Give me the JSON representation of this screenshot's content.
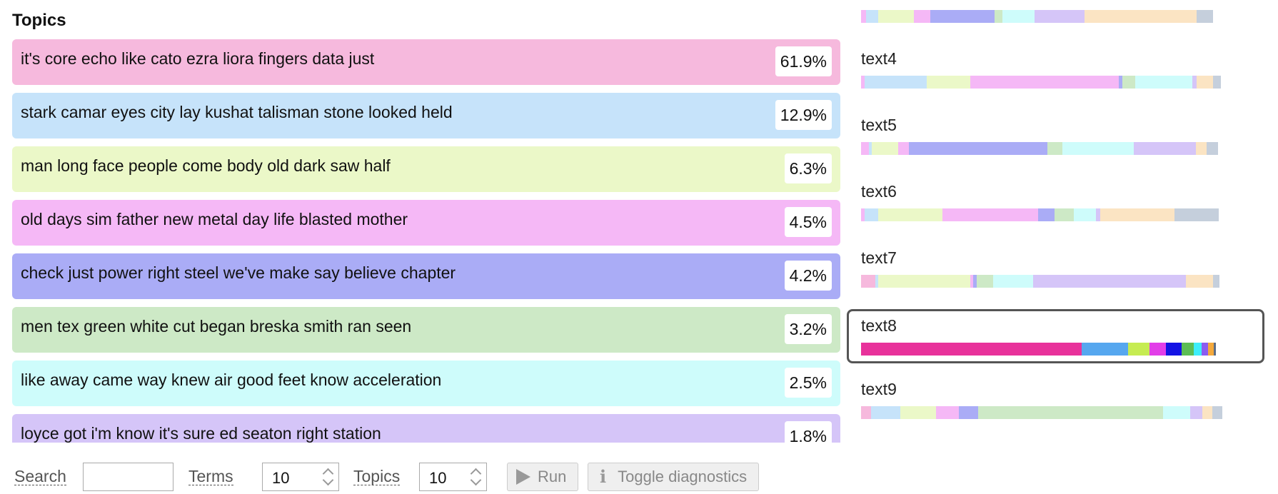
{
  "topics_panel": {
    "title": "Topics",
    "topics": [
      {
        "label": "it's core echo like cato ezra liora fingers data just",
        "pct": "61.9%",
        "color": "#f6b9dd"
      },
      {
        "label": "stark camar eyes city lay kushat talisman stone looked held",
        "pct": "12.9%",
        "color": "#c6e3fa"
      },
      {
        "label": "man long face people come body old dark saw half",
        "pct": "6.3%",
        "color": "#ebf8c8"
      },
      {
        "label": "old days sim father new metal day life blasted mother",
        "pct": "4.5%",
        "color": "#f5b8f6"
      },
      {
        "label": "check just power right steel we've make say believe chapter",
        "pct": "4.2%",
        "color": "#aaacf6"
      },
      {
        "label": "men tex green white cut began breska smith ran seen",
        "pct": "3.2%",
        "color": "#cde9c6"
      },
      {
        "label": "like away came way knew air good feet know acceleration",
        "pct": "2.5%",
        "color": "#cefcfb"
      },
      {
        "label": "loyce got i'm know it's sure ed seaton right station",
        "pct": "1.8%",
        "color": "#d5c5f8"
      }
    ]
  },
  "controls": {
    "search_label": "Search",
    "search_value": "",
    "terms_label": "Terms",
    "terms_value": "10",
    "topics_label": "Topics",
    "topics_value": "10",
    "run_label": "Run",
    "run_icon": "play-icon",
    "toggle_label": "Toggle diagnostics",
    "toggle_icon": "info-icon"
  },
  "documents": [
    {
      "name": "",
      "selected": false,
      "segments": [
        {
          "color": "#f5b8f6",
          "frac": 0.012
        },
        {
          "color": "#c6e3fa",
          "frac": 0.03
        },
        {
          "color": "#ebf8c8",
          "frac": 0.09
        },
        {
          "color": "#f5b8f6",
          "frac": 0.04
        },
        {
          "color": "#aaacf6",
          "frac": 0.16
        },
        {
          "color": "#cde9c6",
          "frac": 0.02
        },
        {
          "color": "#cefcfb",
          "frac": 0.08
        },
        {
          "color": "#d5c5f8",
          "frac": 0.125
        },
        {
          "color": "#fbe4c3",
          "frac": 0.28
        },
        {
          "color": "#c5cfdc",
          "frac": 0.04
        }
      ]
    },
    {
      "name": "text4",
      "selected": false,
      "segments": [
        {
          "color": "#f5b8f6",
          "frac": 0.008
        },
        {
          "color": "#c6e3fa",
          "frac": 0.155
        },
        {
          "color": "#ebf8c8",
          "frac": 0.11
        },
        {
          "color": "#f5b8f6",
          "frac": 0.37
        },
        {
          "color": "#aaacf6",
          "frac": 0.008
        },
        {
          "color": "#cde9c6",
          "frac": 0.033
        },
        {
          "color": "#cefcfb",
          "frac": 0.142
        },
        {
          "color": "#d5c5f8",
          "frac": 0.01
        },
        {
          "color": "#fbe4c3",
          "frac": 0.042
        },
        {
          "color": "#c5cfdc",
          "frac": 0.018
        }
      ]
    },
    {
      "name": "text5",
      "selected": false,
      "segments": [
        {
          "color": "#f5b8f6",
          "frac": 0.02
        },
        {
          "color": "#c6e3fa",
          "frac": 0.006
        },
        {
          "color": "#ebf8c8",
          "frac": 0.067
        },
        {
          "color": "#f5b8f6",
          "frac": 0.026
        },
        {
          "color": "#aaacf6",
          "frac": 0.345
        },
        {
          "color": "#cde9c6",
          "frac": 0.037
        },
        {
          "color": "#cefcfb",
          "frac": 0.178
        },
        {
          "color": "#d5c5f8",
          "frac": 0.156
        },
        {
          "color": "#fbe4c3",
          "frac": 0.026
        },
        {
          "color": "#c5cfdc",
          "frac": 0.028
        }
      ]
    },
    {
      "name": "text6",
      "selected": false,
      "segments": [
        {
          "color": "#f5b8f6",
          "frac": 0.008
        },
        {
          "color": "#c6e3fa",
          "frac": 0.035
        },
        {
          "color": "#ebf8c8",
          "frac": 0.16
        },
        {
          "color": "#f5b8f6",
          "frac": 0.238
        },
        {
          "color": "#aaacf6",
          "frac": 0.042
        },
        {
          "color": "#cde9c6",
          "frac": 0.048
        },
        {
          "color": "#cefcfb",
          "frac": 0.055
        },
        {
          "color": "#d5c5f8",
          "frac": 0.01
        },
        {
          "color": "#fbe4c3",
          "frac": 0.185
        },
        {
          "color": "#c5cfdc",
          "frac": 0.11
        }
      ]
    },
    {
      "name": "text7",
      "selected": false,
      "segments": [
        {
          "color": "#f6b9dd",
          "frac": 0.035
        },
        {
          "color": "#c6e3fa",
          "frac": 0.008
        },
        {
          "color": "#ebf8c8",
          "frac": 0.23
        },
        {
          "color": "#f5b8f6",
          "frac": 0.006
        },
        {
          "color": "#aaacf6",
          "frac": 0.01
        },
        {
          "color": "#cde9c6",
          "frac": 0.04
        },
        {
          "color": "#cefcfb",
          "frac": 0.1
        },
        {
          "color": "#d5c5f8",
          "frac": 0.38
        },
        {
          "color": "#fbe4c3",
          "frac": 0.068
        },
        {
          "color": "#c5cfdc",
          "frac": 0.016
        }
      ]
    },
    {
      "name": "text8",
      "selected": true,
      "segments": [
        {
          "color": "#e8329b",
          "frac": 0.552
        },
        {
          "color": "#56a7ef",
          "frac": 0.115
        },
        {
          "color": "#c6ec52",
          "frac": 0.055
        },
        {
          "color": "#e23ee8",
          "frac": 0.04
        },
        {
          "color": "#1413e4",
          "frac": 0.04
        },
        {
          "color": "#5cbd55",
          "frac": 0.03
        },
        {
          "color": "#3deefa",
          "frac": 0.02
        },
        {
          "color": "#8b5cf0",
          "frac": 0.015
        },
        {
          "color": "#f4a93c",
          "frac": 0.015
        },
        {
          "color": "#5c6d86",
          "frac": 0.006
        }
      ]
    },
    {
      "name": "text9",
      "selected": false,
      "segments": [
        {
          "color": "#f6b9dd",
          "frac": 0.025
        },
        {
          "color": "#c6e3fa",
          "frac": 0.072
        },
        {
          "color": "#ebf8c8",
          "frac": 0.09
        },
        {
          "color": "#f5b8f6",
          "frac": 0.057
        },
        {
          "color": "#aaacf6",
          "frac": 0.048
        },
        {
          "color": "#cde9c6",
          "frac": 0.46
        },
        {
          "color": "#cefcfb",
          "frac": 0.068
        },
        {
          "color": "#d5c5f8",
          "frac": 0.03
        },
        {
          "color": "#fbe4c3",
          "frac": 0.025
        },
        {
          "color": "#c5cfdc",
          "frac": 0.025
        }
      ]
    }
  ]
}
